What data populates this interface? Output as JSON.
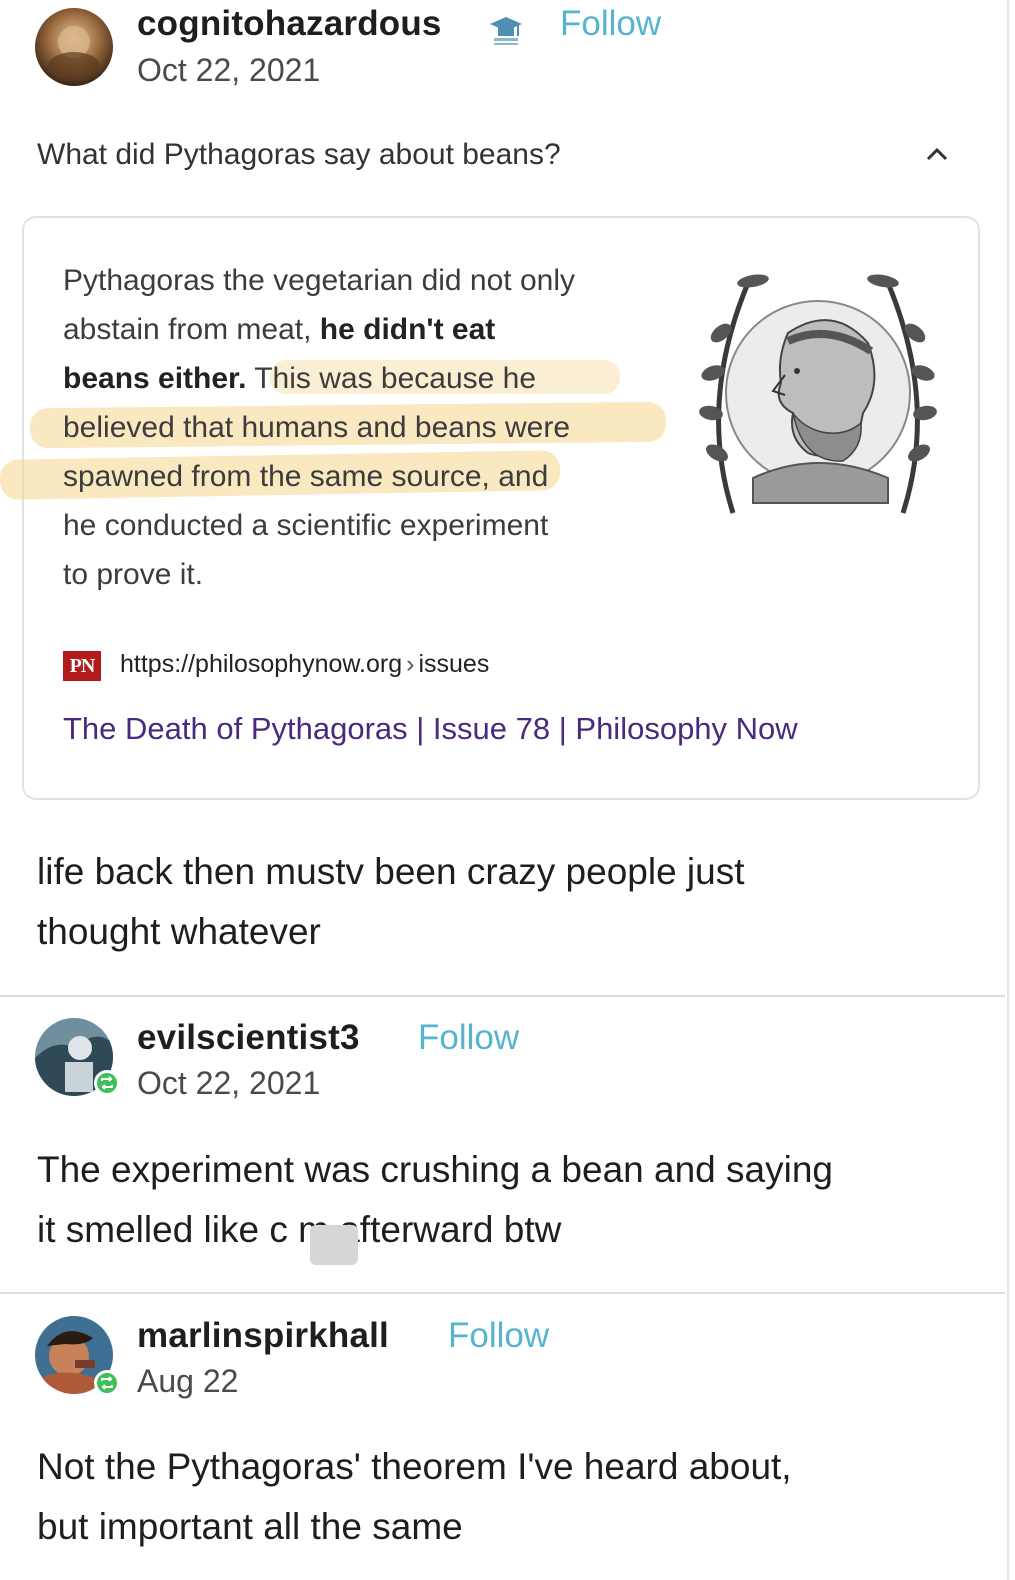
{
  "posts": [
    {
      "username": "cognitohazardous",
      "follow_label": "Follow",
      "date": "Oct 22, 2021",
      "question": "What did Pythagoras say about beans?",
      "snippet": {
        "line1": "Pythagoras the vegetarian did not only",
        "line2a": "abstain from meat, ",
        "line2b": "he didn't eat",
        "line3a": "beans either.",
        "line3b": " This was because he",
        "line4": "believed that humans and beans were",
        "line5": "spawned from the same source, and",
        "line6": "he conducted a scientific experiment",
        "line7": "to prove it."
      },
      "source": {
        "logo_text": "PN",
        "url": "https://philosophynow.org",
        "url_sep": "›",
        "url_path": "issues",
        "title": "The Death of Pythagoras | Issue 78 | Philosophy Now"
      },
      "text_lines": [
        "life back then mustv been crazy people just",
        "thought whatever"
      ],
      "icons": {
        "badge": "graduation-cap-icon",
        "caret": "chevron-up-icon"
      }
    },
    {
      "username": "evilscientist3",
      "follow_label": "Follow",
      "date": "Oct 22, 2021",
      "text_lines": [
        "The experiment was crushing a bean and saying",
        "it smelled like c  m afterward btw"
      ],
      "icons": {
        "badge": "reblog-icon"
      }
    },
    {
      "username": "marlinspirkhall",
      "follow_label": "Follow",
      "date": "Aug 22",
      "text_lines": [
        "Not the Pythagoras' theorem I've heard about,",
        "but important all the same"
      ],
      "icons": {
        "badge": "reblog-icon"
      }
    }
  ],
  "colors": {
    "follow": "#56b4cf",
    "link_title": "#4a2a7e",
    "highlight": "#f4d68c",
    "badge": "#3fbf5a"
  }
}
